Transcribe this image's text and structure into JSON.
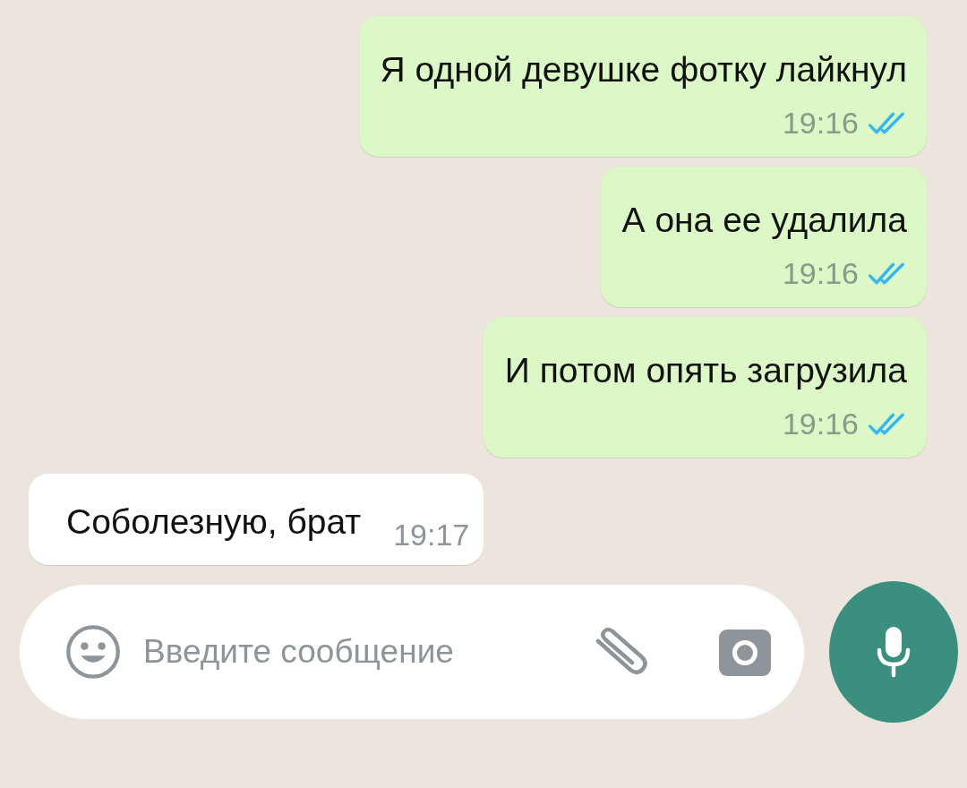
{
  "messages": [
    {
      "kind": "outgoing",
      "text": "Я одной девушке фотку лайкнул",
      "time": "19:16",
      "read": true
    },
    {
      "kind": "outgoing",
      "text": "А она ее удалила",
      "time": "19:16",
      "read": true
    },
    {
      "kind": "outgoing",
      "text": "И потом опять загрузила",
      "time": "19:16",
      "read": true
    },
    {
      "kind": "incoming",
      "text": "Соболезную, брат",
      "time": "19:17"
    }
  ],
  "composer": {
    "placeholder": "Введите сообщение"
  }
}
